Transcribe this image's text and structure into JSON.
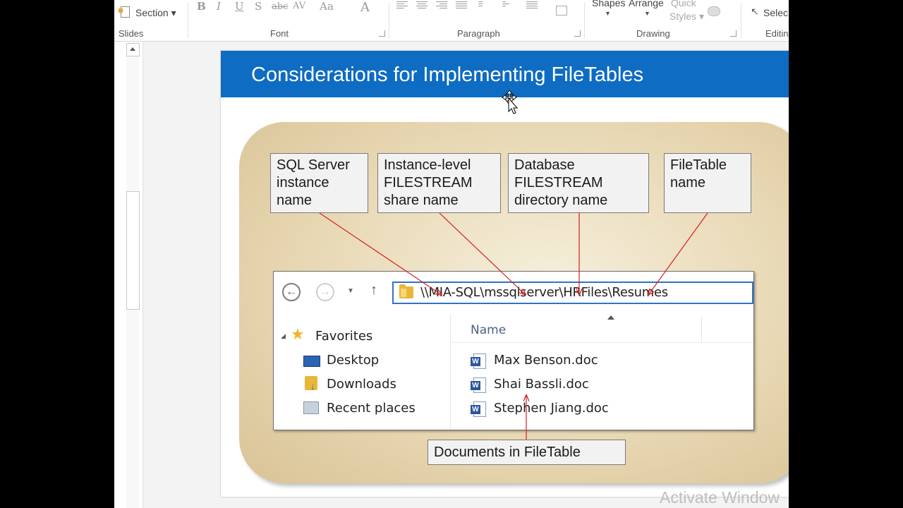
{
  "ribbon": {
    "section_label": "Section",
    "groups": {
      "slides": "Slides",
      "font": "Font",
      "paragraph": "Paragraph",
      "drawing": "Drawing",
      "editing": "Editin"
    },
    "font_buttons": [
      "B",
      "I",
      "U",
      "S",
      "abc",
      "AV",
      "Aa",
      "A"
    ],
    "drawing_buttons": {
      "shapes": "Shapes",
      "arrange": "Arrange",
      "quick_styles_line1": "Quick",
      "quick_styles_line2": "Styles"
    },
    "select_label": "Selec"
  },
  "slide": {
    "title": "Considerations for Implementing FileTables",
    "labels": {
      "sql_instance": "SQL Server\ninstance\nname",
      "instance_share": "Instance-level\nFILESTREAM\nshare name",
      "db_directory": "Database\nFILESTREAM\ndirectory name",
      "filetable_name": "FileTable\nname",
      "documents": "Documents in FileTable"
    },
    "explorer": {
      "address": "\\\\MIA-SQL\\mssqlserver\\HRFiles\\Resumes",
      "nav": {
        "favorites": "Favorites",
        "items": [
          "Desktop",
          "Downloads",
          "Recent places"
        ]
      },
      "column_name": "Name",
      "files": [
        "Max Benson.doc",
        "Shai Bassli.doc",
        "Stephen Jiang.doc"
      ]
    }
  },
  "watermark": "Activate Window",
  "colors": {
    "title_bar": "#0e6cc3",
    "arrow": "#d42020",
    "address_border": "#2e74c4",
    "folder": "#e8b73a"
  }
}
